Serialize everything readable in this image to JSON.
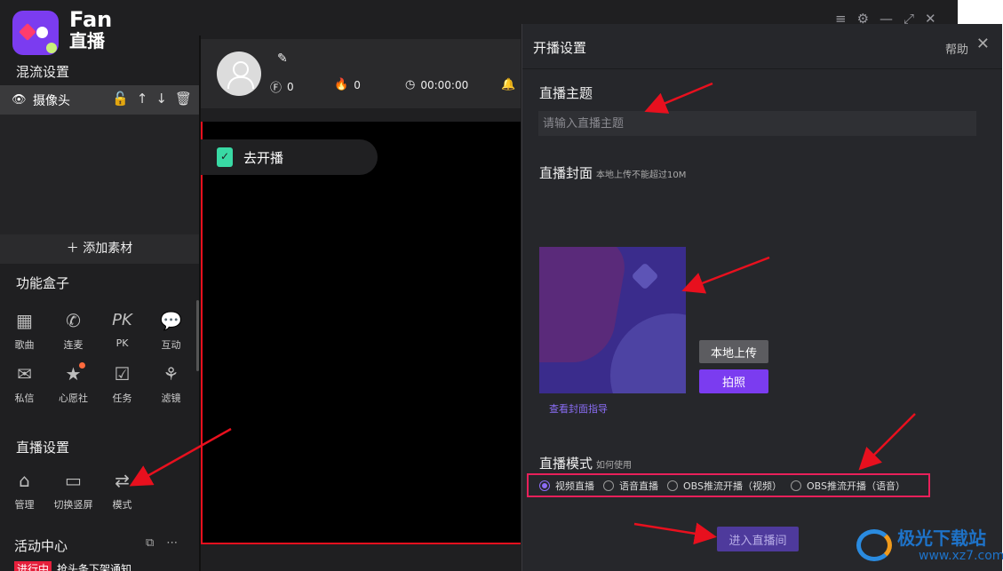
{
  "app": {
    "logo_line1": "Fan",
    "logo_line2": "直播",
    "window_controls": [
      "≡",
      "⚙",
      "—",
      "⤢",
      "✕"
    ]
  },
  "left": {
    "mix_title": "混流设置",
    "camera_label": "摄像头",
    "camera_icons": [
      "lock-icon",
      "arrow-up-icon",
      "arrow-down-icon",
      "trash-icon"
    ],
    "add_material": "添加素材",
    "func_title": "功能盒子",
    "func_items": [
      {
        "label": "歌曲",
        "icon": "songs-icon"
      },
      {
        "label": "连麦",
        "icon": "call-icon"
      },
      {
        "label": "PK",
        "icon": "pk-icon"
      },
      {
        "label": "互动",
        "icon": "chat-icon"
      },
      {
        "label": "私信",
        "icon": "mail-icon"
      },
      {
        "label": "心愿社",
        "icon": "wish-icon"
      },
      {
        "label": "任务",
        "icon": "task-icon"
      },
      {
        "label": "滤镜",
        "icon": "filter-icon"
      }
    ],
    "live_title": "直播设置",
    "live_items": [
      {
        "label": "管理",
        "icon": "manage-icon"
      },
      {
        "label": "切换竖屏",
        "icon": "rotate-icon"
      },
      {
        "label": "模式",
        "icon": "mode-icon"
      }
    ],
    "activity_title": "活动中心",
    "activity_tag": "进行中",
    "activity_text": "抢头条下架通知"
  },
  "header": {
    "stat_coins": "0",
    "stat_fire": "0",
    "stat_time": "00:00:00"
  },
  "preview": {
    "go_live": "去开播"
  },
  "dialog": {
    "title": "开播设置",
    "help": "帮助",
    "topic_label": "直播主题",
    "topic_placeholder": "请输入直播主题",
    "cover_label": "直播封面",
    "cover_hint": "本地上传不能超过10M",
    "cover_guide": "查看封面指导",
    "upload_button": "本地上传",
    "photo_button": "拍照",
    "mode_label": "直播模式",
    "mode_hint": "如何使用",
    "modes": [
      {
        "label": "视频直播",
        "selected": true
      },
      {
        "label": "语音直播",
        "selected": false
      },
      {
        "label": "OBS推流开播（视频）",
        "selected": false
      },
      {
        "label": "OBS推流开播（语音）",
        "selected": false
      }
    ],
    "enter_button": "进入直播间"
  },
  "watermark": {
    "line1": "极光下载站",
    "line2": "www.xz7.com"
  }
}
